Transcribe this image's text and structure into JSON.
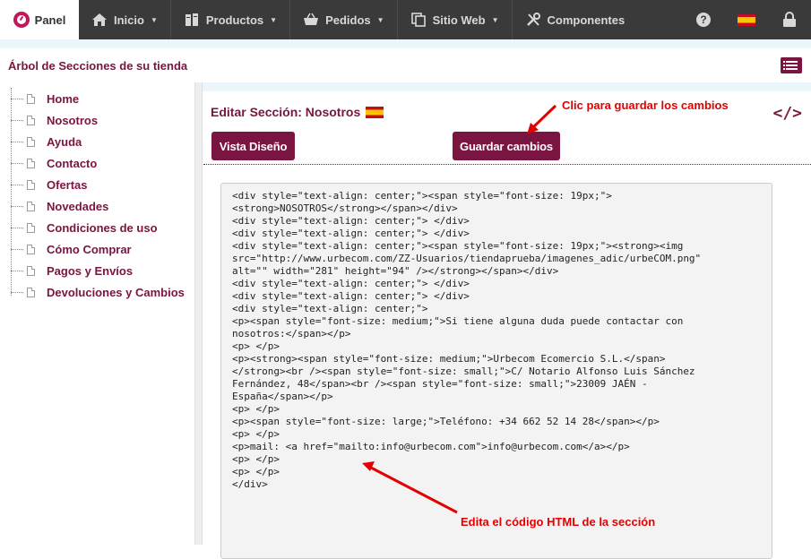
{
  "nav": {
    "brand": "Panel",
    "items": [
      {
        "label": "Inicio",
        "icon": "home-icon",
        "caret": "▼"
      },
      {
        "label": "Productos",
        "icon": "products-icon",
        "caret": "▼"
      },
      {
        "label": "Pedidos",
        "icon": "basket-icon",
        "caret": "▼"
      },
      {
        "label": "Sitio Web",
        "icon": "copy-icon",
        "caret": "▼"
      },
      {
        "label": "Componentes",
        "icon": "tools-icon",
        "caret": ""
      }
    ],
    "help": "?",
    "right_icons": [
      "help-icon",
      "spain-flag-icon",
      "lock-icon"
    ]
  },
  "sidebar": {
    "title": "Árbol de Secciones de su tienda",
    "items": [
      "Home",
      "Nosotros",
      "Ayuda",
      "Contacto",
      "Ofertas",
      "Novedades",
      "Condiciones de uso",
      "Cómo Comprar",
      "Pagos y Envíos",
      "Devoluciones y Cambios"
    ]
  },
  "editor": {
    "heading": "Editar Sección: Nosotros",
    "code_toggle": "</>",
    "view_button": "Vista Diseño",
    "save_button": "Guardar cambios",
    "code": "<div style=\"text-align: center;\"><span style=\"font-size: 19px;\">\n<strong>NOSOTROS</strong></span></div>\n<div style=\"text-align: center;\"> </div>\n<div style=\"text-align: center;\"> </div>\n<div style=\"text-align: center;\"><span style=\"font-size: 19px;\"><strong><img\nsrc=\"http://www.urbecom.com/ZZ-Usuarios/tiendaprueba/imagenes_adic/urbeCOM.png\"\nalt=\"\" width=\"281\" height=\"94\" /></strong></span></div>\n<div style=\"text-align: center;\"> </div>\n<div style=\"text-align: center;\"> </div>\n<div style=\"text-align: center;\">\n<p><span style=\"font-size: medium;\">Si tiene alguna duda puede contactar con\nnosotros:</span></p>\n<p> </p>\n<p><strong><span style=\"font-size: medium;\">Urbecom Ecomercio S.L.</span>\n</strong><br /><span style=\"font-size: small;\">C/ Notario Alfonso Luis Sánchez\nFernández, 48</span><br /><span style=\"font-size: small;\">23009 JAÉN -\nEspaña</span></p>\n<p> </p>\n<p><span style=\"font-size: large;\">Teléfono: +34 662 52 14 28</span></p>\n<p> </p>\n<p>mail: <a href=\"mailto:info@urbecom.com\">info@urbecom.com</a></p>\n<p> </p>\n<p> </p>\n</div>"
  },
  "annotations": {
    "save_hint": "Clic para guardar los cambios",
    "edit_hint": "Edita el código HTML de la sección"
  },
  "colors": {
    "accent": "#7a1440",
    "nav_bg": "#3a3a3a",
    "annotation": "#e30000"
  }
}
